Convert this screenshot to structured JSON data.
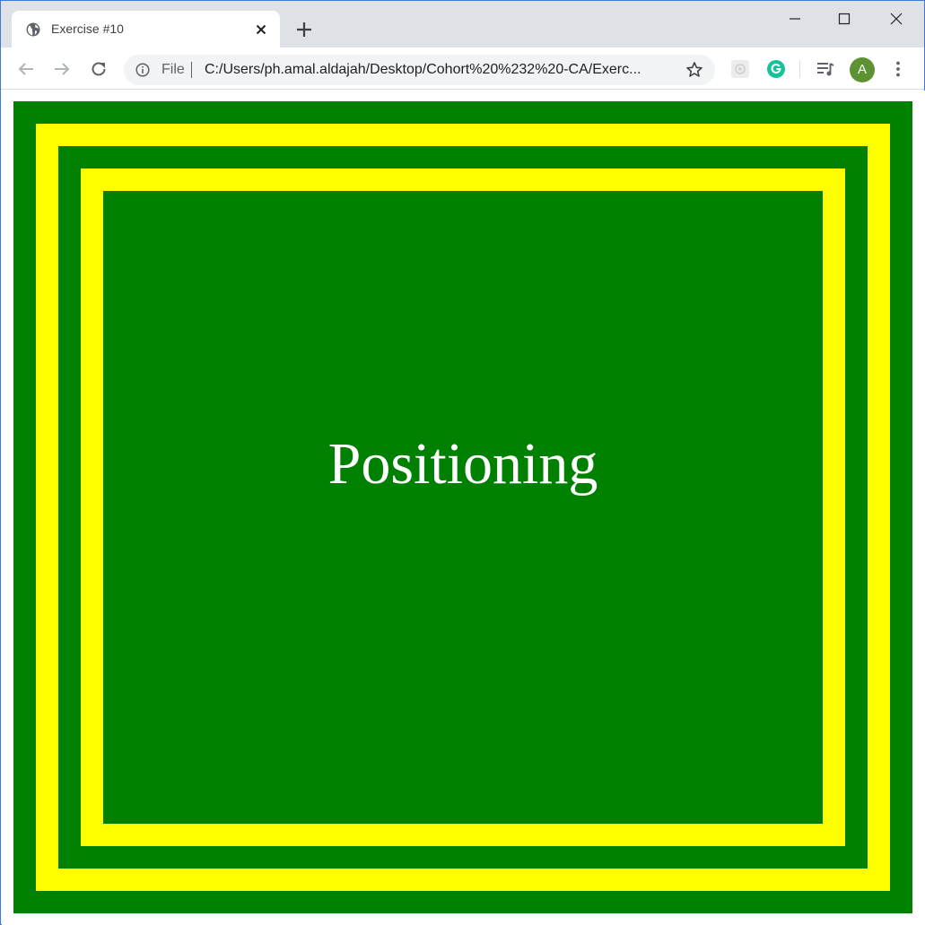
{
  "browser": {
    "tab_title": "Exercise #10",
    "address_scheme_label": "File",
    "url": "C:/Users/ph.amal.aldajah/Desktop/Cohort%20%232%20-CA/Exerc...",
    "profile_initial": "A"
  },
  "page": {
    "heading": "Positioning"
  },
  "colors": {
    "green": "#008000",
    "yellow": "#ffff00",
    "text": "#ffffff"
  }
}
